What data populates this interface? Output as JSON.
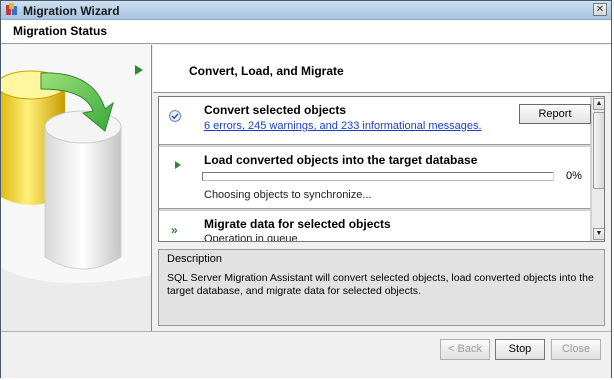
{
  "window": {
    "title": "Migration Wizard",
    "close_glyph": "✕"
  },
  "header": {
    "title": "Migration Status"
  },
  "step": {
    "title": "Convert, Load, and Migrate"
  },
  "items": [
    {
      "title": "Convert selected objects",
      "link": "6 errors, 245 warnings, and 233 informational messages.",
      "button": "Report",
      "icon": "check-circle-icon"
    },
    {
      "title": "Load converted objects into the target database",
      "progress_percent": 0,
      "progress_label": "0%",
      "status": "Choosing objects to synchronize...",
      "icon": "play-icon"
    },
    {
      "title": "Migrate data for selected objects",
      "status": "Operation in queue",
      "icon": "double-arrow-icon"
    }
  ],
  "description": {
    "label": "Description",
    "text": "SQL Server Migration Assistant will convert selected objects, load converted objects into the target database, and migrate data for selected objects."
  },
  "footer": {
    "back": "< Back",
    "stop": "Stop",
    "close": "Close"
  },
  "colors": {
    "accent": "#2e8b2e",
    "link": "#1a3fcf",
    "title_bar": "#b9d1ea"
  }
}
